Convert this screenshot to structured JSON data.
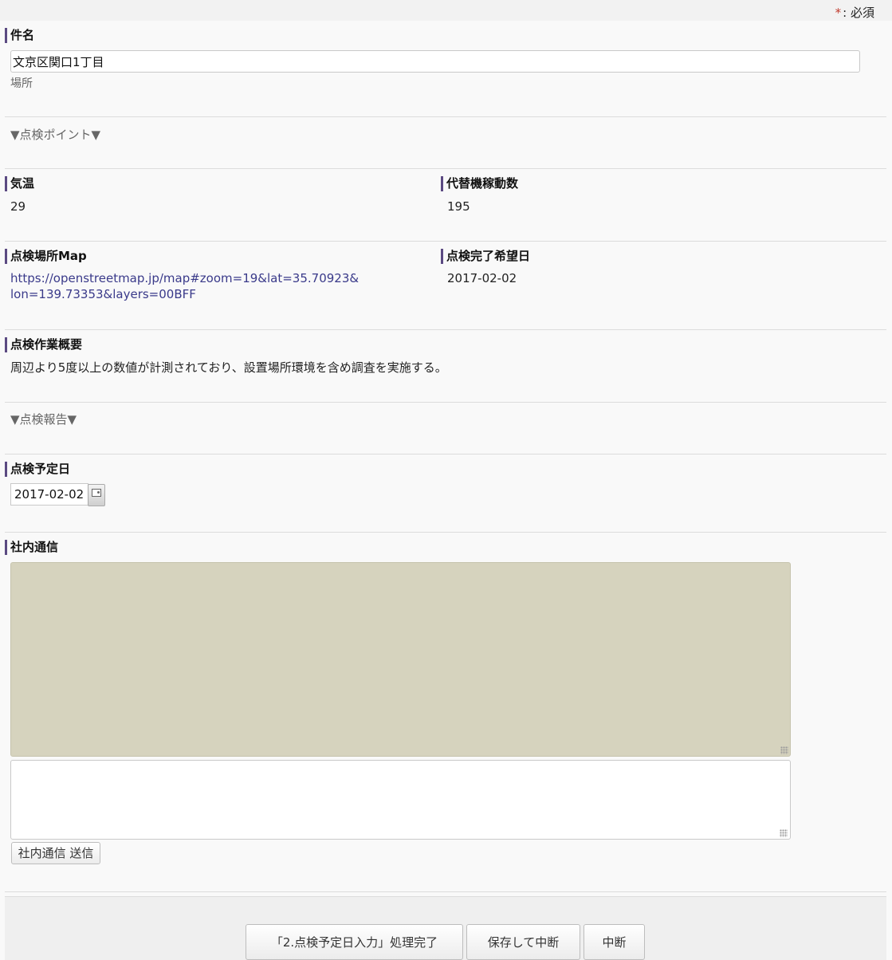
{
  "required_note": {
    "star": "*",
    "text": ": 必須"
  },
  "subject": {
    "label": "件名",
    "value": "文京区関口1丁目",
    "hint": "場所"
  },
  "sections": {
    "inspection_point": "▼点検ポイント▼",
    "inspection_report": "▼点検報告▼"
  },
  "temperature": {
    "label": "気温",
    "value": "29"
  },
  "alt_machine_count": {
    "label": "代替機稼動数",
    "value": "195"
  },
  "map": {
    "label": "点検場所Map",
    "url_line1": "https://openstreetmap.jp/map#zoom=19&lat=35.70923&",
    "url_line2": "lon=139.73353&layers=00BFF"
  },
  "desired_date": {
    "label": "点検完了希望日",
    "value": "2017-02-02"
  },
  "summary": {
    "label": "点検作業概要",
    "value": "周辺より5度以上の数値が計測されており、設置場所環境を含め調査を実施する。"
  },
  "scheduled_date": {
    "label": "点検予定日",
    "value": "2017-02-02"
  },
  "internal_comm": {
    "label": "社内通信",
    "send_label": "社内通信 送信"
  },
  "footer": {
    "complete_label": "「2.点検予定日入力」処理完了",
    "save_suspend_label": "保存して中断",
    "suspend_label": "中断"
  },
  "colors": {
    "label_accent": "#5b4a82",
    "log_bg": "#d6d3be",
    "link": "#3a3a8a",
    "required_star": "#c0392b"
  }
}
